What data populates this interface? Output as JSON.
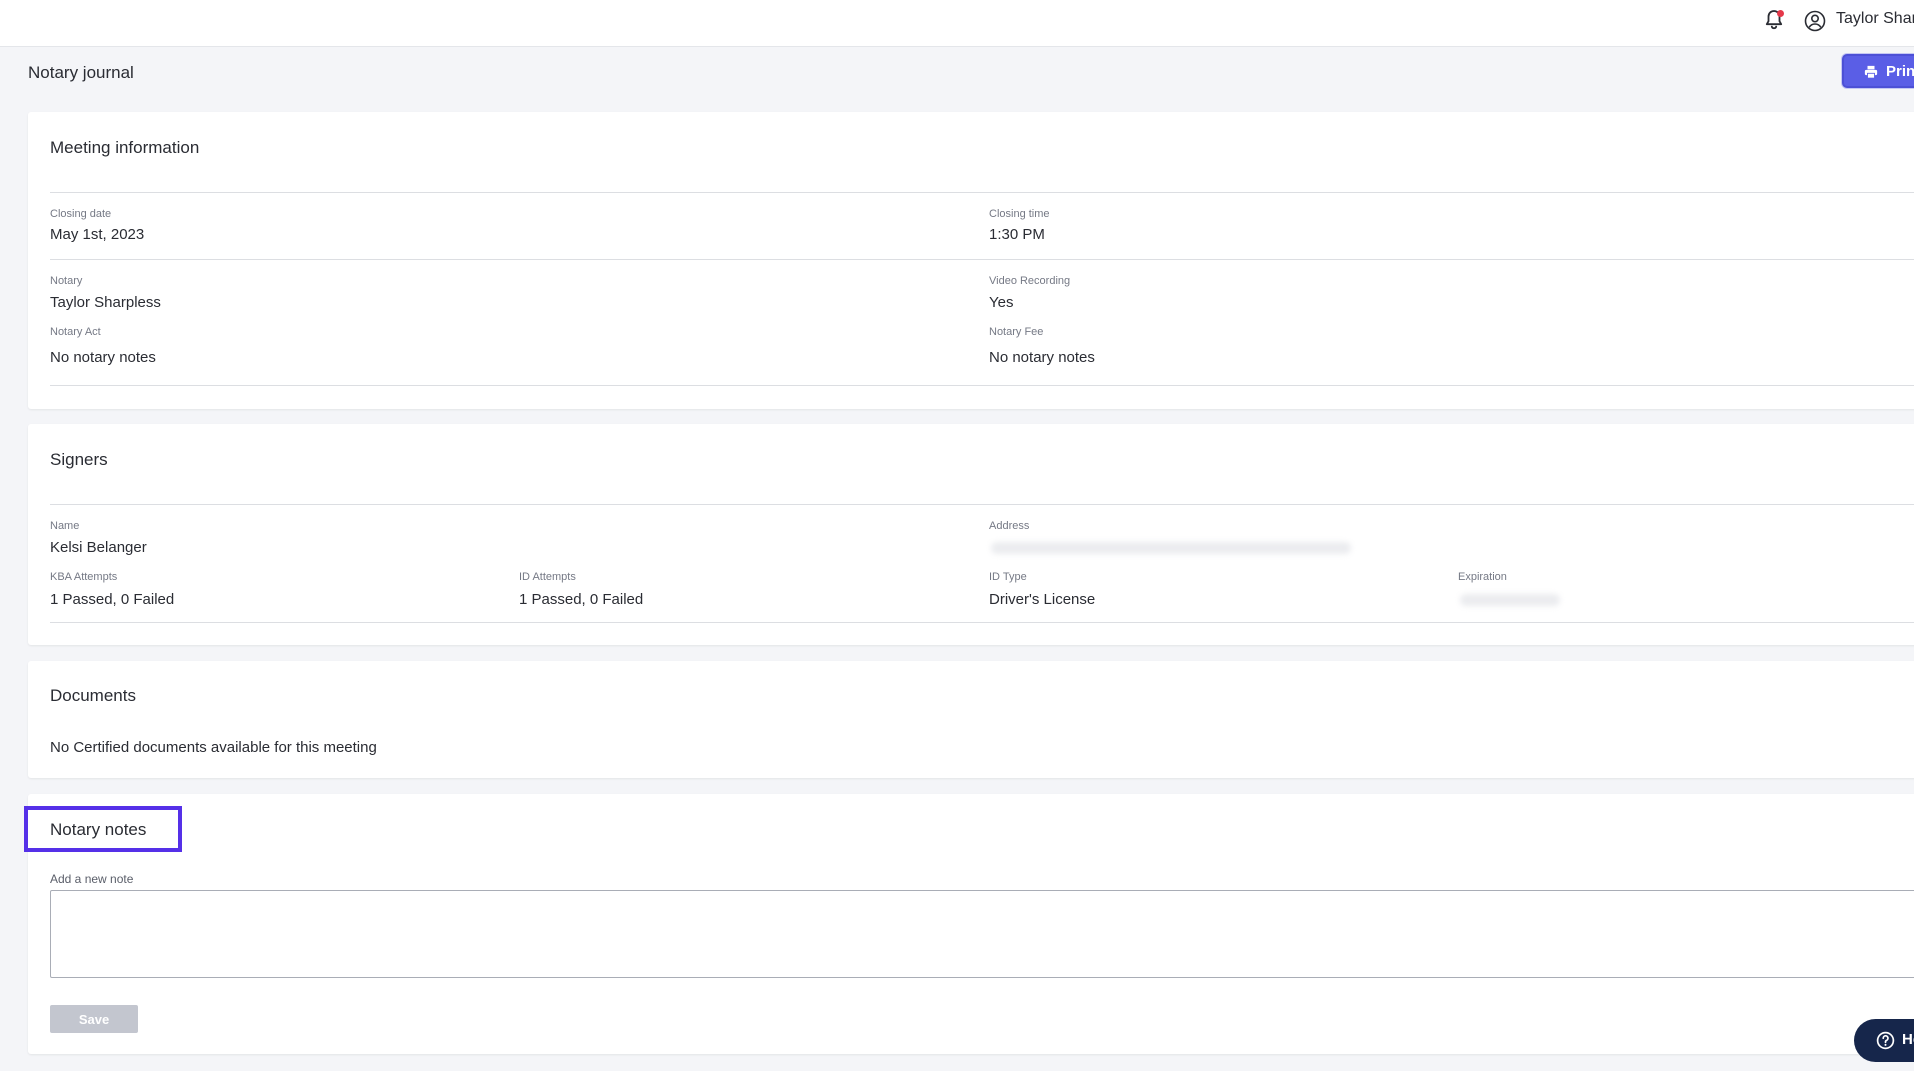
{
  "header": {
    "user_name": "Taylor Shar",
    "bell_icon": "bell-icon",
    "user_icon": "user-circle-icon"
  },
  "page": {
    "title": "Notary journal",
    "print_label": "Prin",
    "print_icon": "printer-icon"
  },
  "meeting": {
    "title": "Meeting information",
    "closing_date_label": "Closing date",
    "closing_date": "May 1st, 2023",
    "closing_time_label": "Closing time",
    "closing_time": "1:30 PM",
    "notary_label": "Notary",
    "notary": "Taylor Sharpless",
    "video_label": "Video Recording",
    "video": "Yes",
    "act_label": "Notary Act",
    "act": "No notary notes",
    "fee_label": "Notary Fee",
    "fee": "No notary notes"
  },
  "signers": {
    "title": "Signers",
    "name_label": "Name",
    "name": "Kelsi Belanger",
    "address_label": "Address",
    "kba_label": "KBA Attempts",
    "kba": "1 Passed, 0 Failed",
    "id_attempts_label": "ID Attempts",
    "id_attempts": "1 Passed, 0 Failed",
    "id_type_label": "ID Type",
    "id_type": "Driver's License",
    "expiration_label": "Expiration"
  },
  "documents": {
    "title": "Documents",
    "empty_text": "No Certified documents available for this meeting"
  },
  "notes": {
    "title": "Notary notes",
    "add_label": "Add a new note",
    "note_value": "",
    "save_label": "Save"
  },
  "help": {
    "label": "He",
    "icon": "question-circle-icon"
  },
  "colors": {
    "accent": "#5a5ee6",
    "highlight_border": "#5530e8",
    "help_button": "#16264b",
    "save_disabled": "#c3c6cf"
  }
}
